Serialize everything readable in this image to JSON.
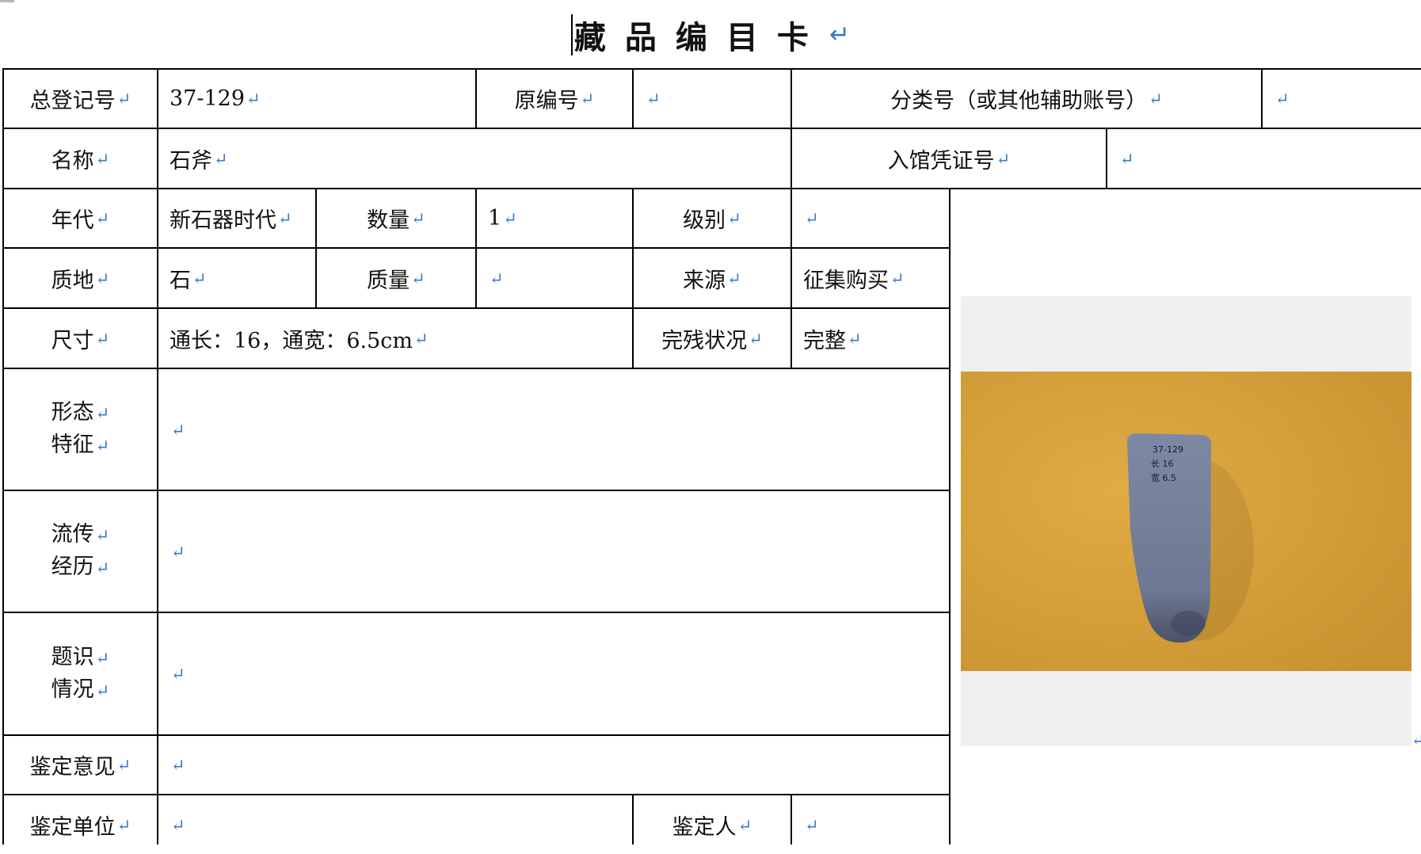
{
  "title": "藏品编目卡",
  "return_mark": "↵",
  "card": {
    "total_reg_no": {
      "label": "总登记号",
      "value": "37-129"
    },
    "original_no": {
      "label": "原编号",
      "value": ""
    },
    "class_no": {
      "label": "分类号（或其他辅助账号）",
      "value": ""
    },
    "name": {
      "label": "名称",
      "value": "石斧"
    },
    "entry_voucher": {
      "label": "入馆凭证号",
      "value": ""
    },
    "era": {
      "label": "年代",
      "value": "新石器时代"
    },
    "quantity": {
      "label": "数量",
      "value": "1"
    },
    "level": {
      "label": "级别",
      "value": ""
    },
    "material": {
      "label": "质地",
      "value": "石"
    },
    "weight": {
      "label": "质量",
      "value": ""
    },
    "source": {
      "label": "来源",
      "value": "征集购买"
    },
    "size": {
      "label": "尺寸",
      "value": "通长：16，通宽：6.5cm"
    },
    "condition": {
      "label": "完残状况",
      "value": "完整"
    },
    "form": {
      "label_1": "形态",
      "label_2": "特征",
      "value": ""
    },
    "history": {
      "label_1": "流传",
      "label_2": "经历",
      "value": ""
    },
    "inscription": {
      "label_1": "题识",
      "label_2": "情况",
      "value": ""
    },
    "appraisal": {
      "label": "鉴定意见",
      "value": ""
    },
    "appraisal_unit": {
      "label": "鉴定单位",
      "value": ""
    },
    "appraiser": {
      "label": "鉴定人",
      "value": ""
    }
  },
  "photo": {
    "label_lines": [
      "37-129",
      "长 16",
      "宽 6.5"
    ],
    "colors": {
      "background": "#d8a034",
      "stone": "#7a85a0",
      "stone_shadow": "#3e4458"
    }
  }
}
